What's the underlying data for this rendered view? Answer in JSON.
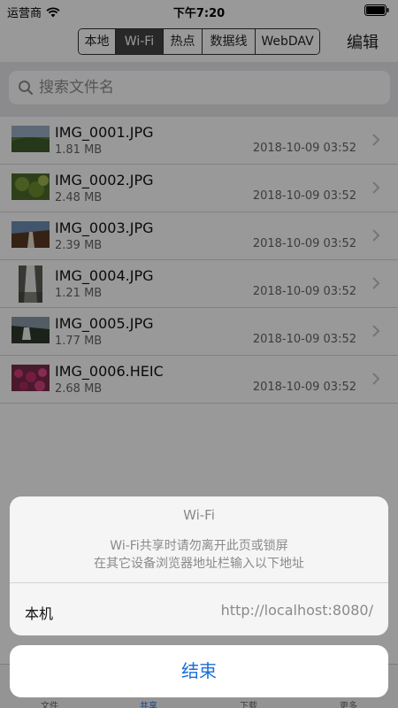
{
  "status_bar": {
    "carrier": "运营商",
    "time": "下午7:20"
  },
  "nav": {
    "segments": [
      "本地",
      "Wi-Fi",
      "热点",
      "数据线",
      "WebDAV"
    ],
    "active_segment": "Wi-Fi",
    "edit_label": "编辑"
  },
  "search": {
    "placeholder": "搜索文件名",
    "value": ""
  },
  "files": [
    {
      "name": "IMG_0001.JPG",
      "size": "1.81 MB",
      "date": "2018-10-09 03:52"
    },
    {
      "name": "IMG_0002.JPG",
      "size": "2.48 MB",
      "date": "2018-10-09 03:52"
    },
    {
      "name": "IMG_0003.JPG",
      "size": "2.39 MB",
      "date": "2018-10-09 03:52"
    },
    {
      "name": "IMG_0004.JPG",
      "size": "1.21 MB",
      "date": "2018-10-09 03:52"
    },
    {
      "name": "IMG_0005.JPG",
      "size": "1.77 MB",
      "date": "2018-10-09 03:52"
    },
    {
      "name": "IMG_0006.HEIC",
      "size": "2.68 MB",
      "date": "2018-10-09 03:52"
    }
  ],
  "tab_bar": {
    "items": [
      "文件",
      "共享",
      "下载",
      "更多"
    ],
    "active": "共享"
  },
  "sheet": {
    "title": "Wi-Fi",
    "message_line1": "Wi-Fi共享时请勿离开此页或锁屏",
    "message_line2": "在其它设备浏览器地址栏输入以下地址",
    "row_label": "本机",
    "row_value": "http://localhost:8080/",
    "cancel_label": "结束"
  },
  "colors": {
    "accent": "#1a6fd8",
    "dim": "rgba(0,0,0,0.4)"
  },
  "icons": [
    "wifi-icon",
    "battery-icon",
    "search-icon",
    "chevron-right-icon"
  ]
}
